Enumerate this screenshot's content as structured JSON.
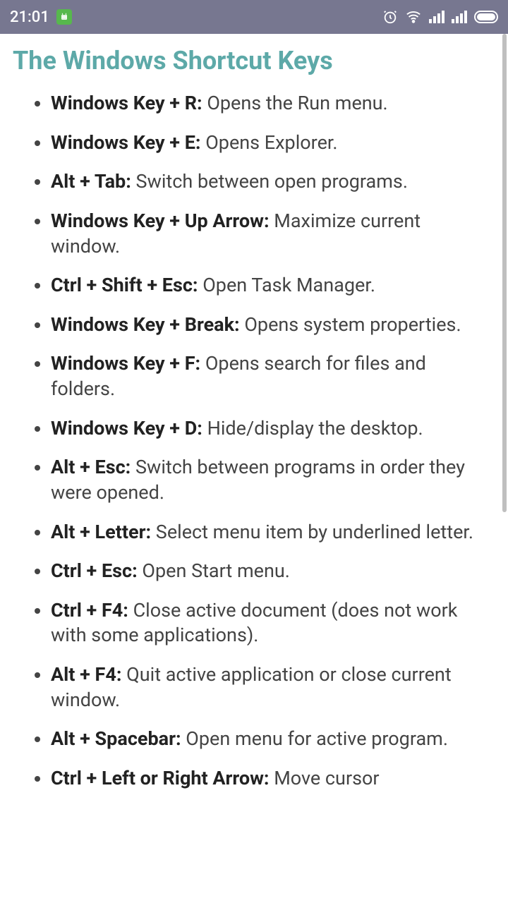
{
  "status_bar": {
    "time": "21:01",
    "app_icon": "android-robot-icon",
    "icons": {
      "alarm": "alarm-icon",
      "wifi": "wifi-icon",
      "signal_1": "signal-icon",
      "signal_2": "signal-icon",
      "battery": "battery-icon"
    }
  },
  "page": {
    "title": "The Windows Shortcut Keys"
  },
  "shortcuts": [
    {
      "key": "Windows Key + R:",
      "desc": " Opens the Run menu."
    },
    {
      "key": "Windows Key + E:",
      "desc": " Opens Explorer."
    },
    {
      "key": "Alt + Tab:",
      "desc": " Switch between open programs."
    },
    {
      "key": "Windows Key + Up Arrow:",
      "desc": " Maximize current window."
    },
    {
      "key": "Ctrl + Shift + Esc:",
      "desc": " Open Task Manager."
    },
    {
      "key": "Windows Key + Break:",
      "desc": " Opens system properties."
    },
    {
      "key": "Windows Key + F:",
      "desc": " Opens search for files and folders."
    },
    {
      "key": "Windows Key + D:",
      "desc": " Hide/display the desktop."
    },
    {
      "key": "Alt + Esc:",
      "desc": " Switch between programs in order they were opened."
    },
    {
      "key": "Alt + Letter:",
      "desc": " Select menu item by underlined letter."
    },
    {
      "key": "Ctrl + Esc:",
      "desc": " Open Start menu."
    },
    {
      "key": "Ctrl + F4:",
      "desc": " Close active document (does not work with some applications)."
    },
    {
      "key": "Alt + F4:",
      "desc": " Quit active application or close current window."
    },
    {
      "key": "Alt + Spacebar:",
      "desc": " Open menu for active program."
    },
    {
      "key": "Ctrl + Left or Right Arrow:",
      "desc": " Move cursor"
    }
  ]
}
